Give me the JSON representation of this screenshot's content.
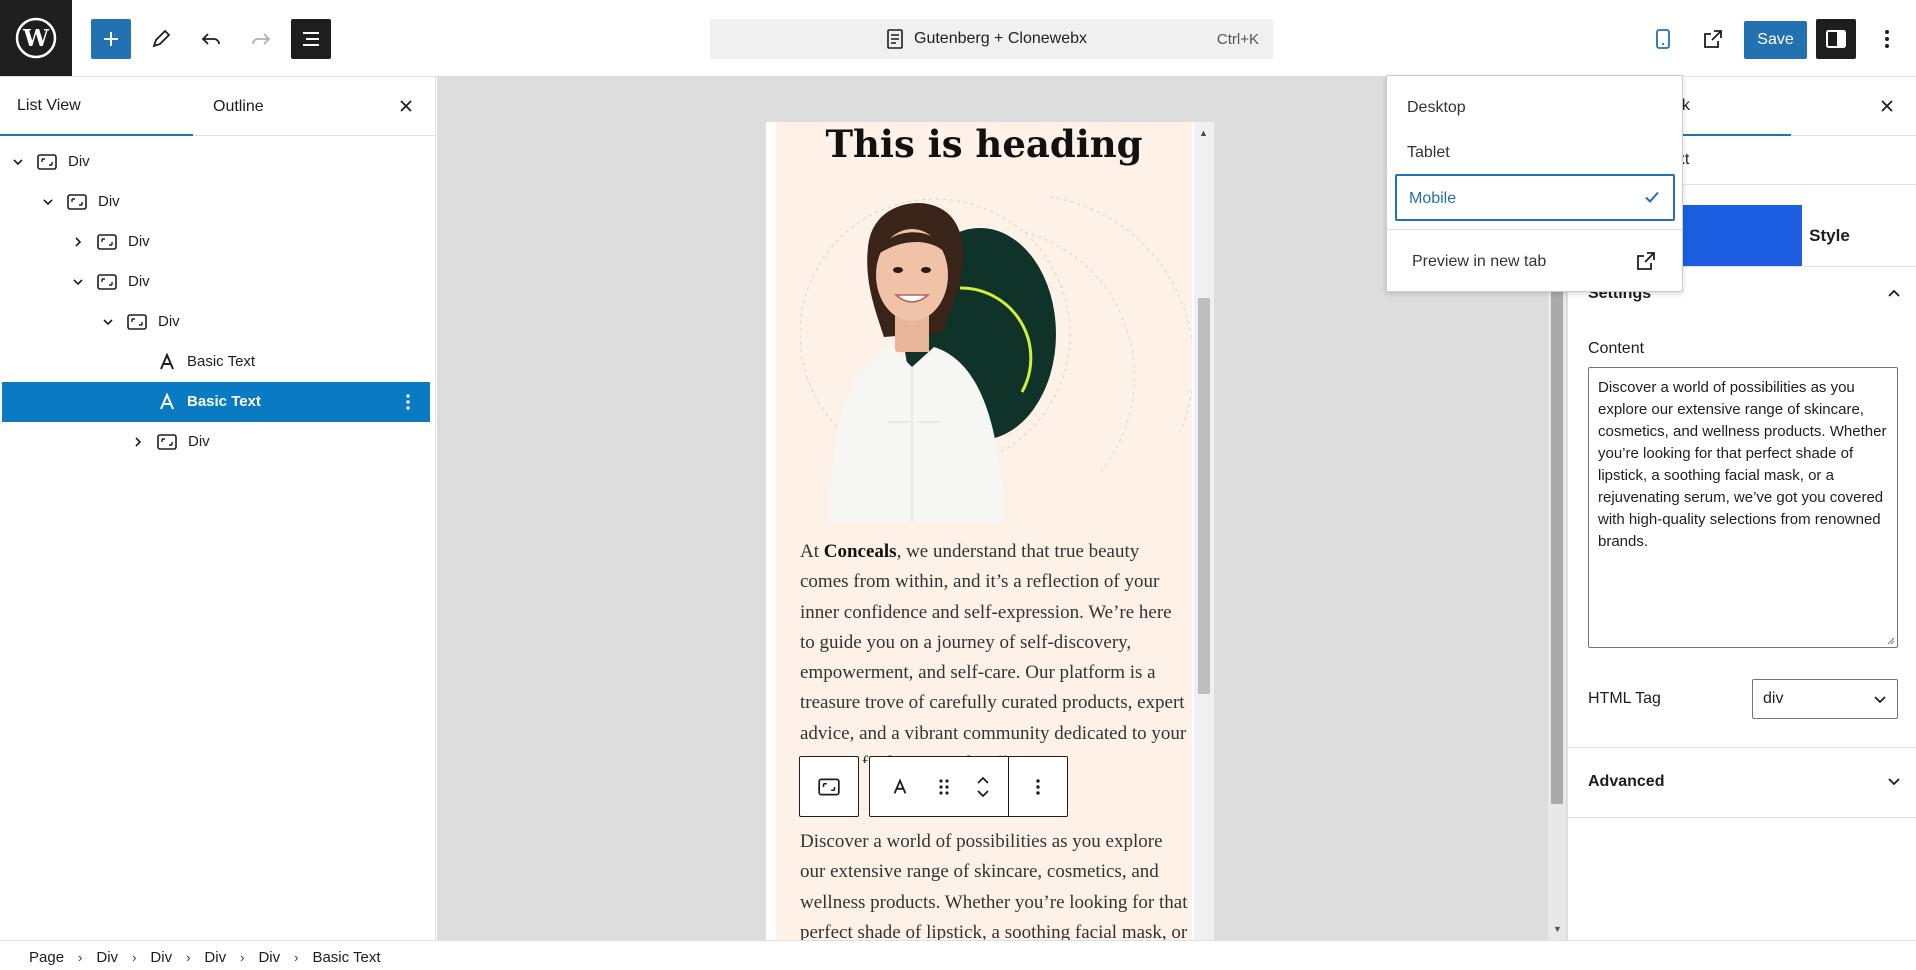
{
  "header": {
    "document_title": "Gutenberg + Clonewebx",
    "command_shortcut": "Ctrl+K",
    "save_label": "Save"
  },
  "left_panel": {
    "tabs": [
      "List View",
      "Outline"
    ],
    "tree": [
      {
        "label": "Div",
        "icon": "div-block-icon",
        "expander": "expanded"
      },
      {
        "label": "Div",
        "icon": "div-block-icon",
        "expander": "expanded"
      },
      {
        "label": "Div",
        "icon": "div-block-icon",
        "expander": "collapsed"
      },
      {
        "label": "Div",
        "icon": "div-block-icon",
        "expander": "expanded"
      },
      {
        "label": "Div",
        "icon": "div-block-icon",
        "expander": "expanded"
      },
      {
        "label": "Basic Text",
        "icon": "text-block-icon",
        "expander": "none"
      },
      {
        "label": "Basic Text",
        "icon": "text-block-icon",
        "expander": "none",
        "selected": true
      },
      {
        "label": "Div",
        "icon": "div-block-icon",
        "expander": "collapsed"
      }
    ]
  },
  "canvas": {
    "heading": "This is heading",
    "paragraph1_prefix": "At ",
    "paragraph1_brand": "Conceals",
    "paragraph1_rest": ", we understand that true beauty comes from within, and it’s a reflection of your inner confidence and self-expression. We’re here to guide you on a journey of self-discovery, empowerment, and self-care. Our platform is a treasure trove of carefully curated products, expert advice, and a vibrant community dedicated to your passion for beauty and wellness.",
    "paragraph2": "Discover a world of possibilities as you explore our extensive range of skincare, cosmetics, and wellness products. Whether you’re looking for that perfect shade of lipstick, a soothing facial mask, or a rejuvenating serum, we’ve got you covered with high-quality selections from renowned brands."
  },
  "preview_menu": {
    "items": [
      "Desktop",
      "Tablet",
      "Mobile"
    ],
    "selected": "Mobile",
    "new_tab_label": "Preview in new tab"
  },
  "inspector": {
    "tab_block_label": "ock",
    "card_title_fragment": "ext",
    "tab_style_label": "Style",
    "settings_section_label": "Settings",
    "content_label": "Content",
    "content_value": "Discover a world of possibilities as you explore our extensive range of skincare, cosmetics, and wellness products. Whether you’re looking for that perfect shade of lipstick, a soothing facial mask, or a rejuvenating serum, we’ve got you covered with high-quality selections from renowned brands.",
    "html_tag_label": "HTML Tag",
    "html_tag_value": "div",
    "advanced_label": "Advanced"
  },
  "breadcrumb": [
    "Page",
    "Div",
    "Div",
    "Div",
    "Div",
    "Basic Text"
  ],
  "colors": {
    "accent": "#2271b1",
    "selected_row": "#0a7ac2",
    "hero_bg": "#fdf1e8",
    "dark_circle": "#0f3328",
    "lime_arc": "#d4ef3a"
  }
}
